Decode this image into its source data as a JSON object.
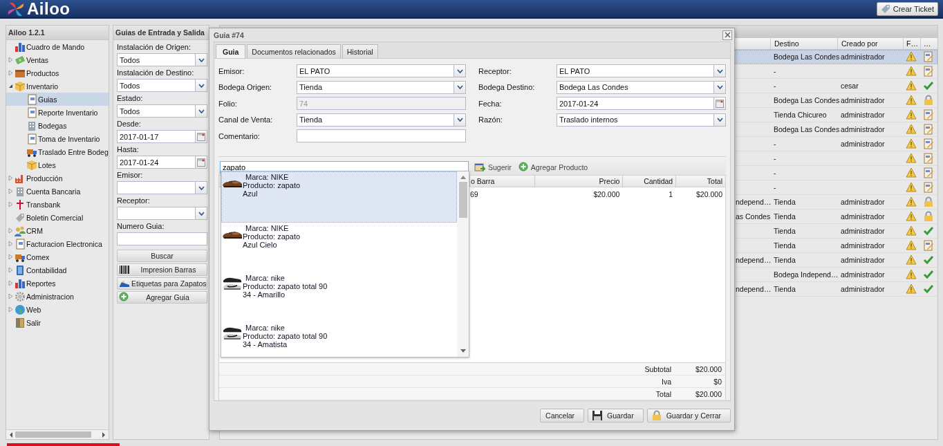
{
  "header": {
    "logo": "Ailoo",
    "button": "Crear Ticket"
  },
  "sidebar": {
    "title": "Ailoo 1.2.1",
    "items": [
      {
        "label": "Cuadro de Mando",
        "selected": false
      },
      {
        "label": "Ventas",
        "expanded": false,
        "selected": false
      },
      {
        "label": "Productos",
        "expanded": false,
        "selected": false
      },
      {
        "label": "Inventario",
        "expanded": true,
        "selected": false,
        "children": [
          {
            "label": "Guias",
            "selected": true
          },
          {
            "label": "Reporte Inventario",
            "selected": false
          },
          {
            "label": "Bodegas",
            "selected": false
          },
          {
            "label": "Toma de Inventario",
            "selected": false
          },
          {
            "label": "Traslado Entre Bodeg",
            "selected": false
          },
          {
            "label": "Lotes",
            "selected": false
          }
        ]
      },
      {
        "label": "Producción",
        "expanded": false,
        "selected": false
      },
      {
        "label": "Cuenta Bancaria",
        "expanded": false,
        "selected": false
      },
      {
        "label": "Transbank",
        "expanded": false,
        "selected": false
      },
      {
        "label": "Boletin Comercial",
        "selected": false
      },
      {
        "label": "CRM",
        "expanded": false,
        "selected": false
      },
      {
        "label": "Facturacion Electronica",
        "expanded": false,
        "selected": false
      },
      {
        "label": "Comex",
        "expanded": false,
        "selected": false
      },
      {
        "label": "Contabilidad",
        "expanded": false,
        "selected": false
      },
      {
        "label": "Reportes",
        "expanded": false,
        "selected": false
      },
      {
        "label": "Administracion",
        "expanded": false,
        "selected": false
      },
      {
        "label": "Web",
        "expanded": false,
        "selected": false
      },
      {
        "label": "Salir",
        "selected": false
      }
    ]
  },
  "filter_panel": {
    "title": "Guias de Entrada y Salida",
    "fields": [
      {
        "label": "Instalación de Origen:",
        "kind": "select",
        "value": "Todos"
      },
      {
        "label": "Instalación de Destino:",
        "kind": "select",
        "value": "Todos"
      },
      {
        "label": "Estado:",
        "kind": "select",
        "value": "Todos"
      },
      {
        "label": "Desde:",
        "kind": "date",
        "value": "2017-01-17"
      },
      {
        "label": "Hasta:",
        "kind": "date",
        "value": "2017-01-24"
      },
      {
        "label": "Emisor:",
        "kind": "select"
      },
      {
        "label": "Receptor:",
        "kind": "select"
      },
      {
        "label": "Numero Guia:",
        "kind": "text"
      }
    ],
    "buttons": [
      {
        "label": "Buscar",
        "kind": "plain"
      },
      {
        "label": "Impresion Barras",
        "kind": "barcode"
      },
      {
        "label": "Etiquetas para Zapatos",
        "kind": "shoe"
      },
      {
        "label": "Agregar Guia",
        "kind": "add"
      }
    ]
  },
  "grid": {
    "columns": [
      "Destino",
      "Creado por",
      "F…",
      "…"
    ],
    "rows": [
      {
        "destino": "Bodega Las Condes",
        "creado_por": "administrador",
        "kind": "edit",
        "selected": true
      },
      {
        "destino": "-",
        "kind": "edit",
        "selected": false
      },
      {
        "destino": "-",
        "creado_por": "cesar",
        "kind": "check",
        "selected": false
      },
      {
        "destino": "Bodega Las Condes",
        "creado_por": "administrador",
        "kind": "lock",
        "selected": false
      },
      {
        "destino": "Tienda Chicureo",
        "creado_por": "administrador",
        "kind": "edit",
        "selected": false
      },
      {
        "destino": "Bodega Las Condes",
        "creado_por": "administrador",
        "kind": "edit",
        "selected": false
      },
      {
        "destino": "-",
        "creado_por": "administrador",
        "kind": "edit",
        "selected": false
      },
      {
        "destino": "-",
        "kind": "edit",
        "selected": false
      },
      {
        "destino": "-",
        "kind": "edit",
        "selected": false
      },
      {
        "destino": "-",
        "kind": "edit",
        "selected": false
      },
      {
        "column_1": "ndepend…",
        "destino": "Tienda",
        "creado_por": "administrador",
        "kind": "lock",
        "selected": false
      },
      {
        "column_1": "as Condes",
        "destino": "Tienda",
        "creado_por": "administrador",
        "kind": "lock",
        "selected": false
      },
      {
        "destino": "Tienda",
        "creado_por": "administrador",
        "kind": "check",
        "selected": false
      },
      {
        "destino": "Tienda",
        "creado_por": "administrador",
        "kind": "edit",
        "selected": false
      },
      {
        "column_1": "ndepend…",
        "destino": "Tienda",
        "creado_por": "administrador",
        "kind": "check",
        "selected": false
      },
      {
        "destino": "Bodega Independ…",
        "creado_por": "administrador",
        "kind": "check",
        "selected": false
      },
      {
        "column_1": "ndepend…",
        "destino": "Tienda",
        "creado_por": "administrador",
        "kind": "check",
        "selected": false
      }
    ]
  },
  "dialog": {
    "title": "Guia #74",
    "tabs": [
      {
        "label": "Guia",
        "selected": true
      },
      {
        "label": "Documentos relacionados",
        "selected": false
      },
      {
        "label": "Historial",
        "selected": false
      }
    ],
    "form_left": [
      {
        "label": "Emisor:",
        "kind": "select",
        "value": "EL PATO"
      },
      {
        "label": "Bodega Origen:",
        "kind": "select",
        "value": "Tienda"
      },
      {
        "label": "Folio:",
        "kind": "text",
        "value": "74",
        "disabled": true
      },
      {
        "label": "Canal de Venta:",
        "kind": "select",
        "value": "Tienda"
      },
      {
        "label": "Comentario:",
        "kind": "text"
      }
    ],
    "form_right": [
      {
        "label": "Receptor:",
        "kind": "select",
        "value": "EL PATO"
      },
      {
        "label": "Bodega Destino:",
        "kind": "select",
        "value": "Bodega Las Condes"
      },
      {
        "label": "Fecha:",
        "kind": "date",
        "value": "2017-01-24"
      },
      {
        "label": "Razón:",
        "kind": "select",
        "value": "Traslado internos"
      }
    ],
    "search": {
      "value": "zapato"
    },
    "toolbar_buttons": [
      {
        "label": "Sugerir",
        "kind": "suggest"
      },
      {
        "label": "Agregar Producto",
        "kind": "add"
      }
    ],
    "products": {
      "columns": [
        "o Barra",
        "Precio",
        "Cantidad",
        "Total"
      ],
      "rows": [
        [
          "69",
          "$20.000",
          "1",
          "$20.000"
        ]
      ]
    },
    "totals": [
      {
        "label": "Subtotal",
        "value": "$20.000"
      },
      {
        "label": "Iva",
        "value": "$0"
      },
      {
        "label": "Total",
        "value": "$20.000"
      }
    ],
    "buttons": [
      {
        "label": "Cancelar",
        "kind": "plain"
      },
      {
        "label": "Guardar",
        "kind": "save"
      },
      {
        "label": "Guardar y Cerrar",
        "kind": "lock"
      }
    ],
    "suggestions": [
      {
        "lines": [
          "Marca: NIKE",
          "Producto: zapato",
          "Azul"
        ],
        "selected": true
      },
      {
        "lines": [
          "Marca: NIKE",
          "Producto: zapato",
          "Azul Cielo"
        ],
        "selected": false
      },
      {
        "lines": [
          "Marca: nike",
          "Producto: zapato total 90",
          "34 - Amarillo"
        ],
        "selected": false
      },
      {
        "lines": [
          "Marca: nike",
          "Producto: zapato total 90",
          "34 - Amatista"
        ],
        "selected": false
      }
    ]
  }
}
